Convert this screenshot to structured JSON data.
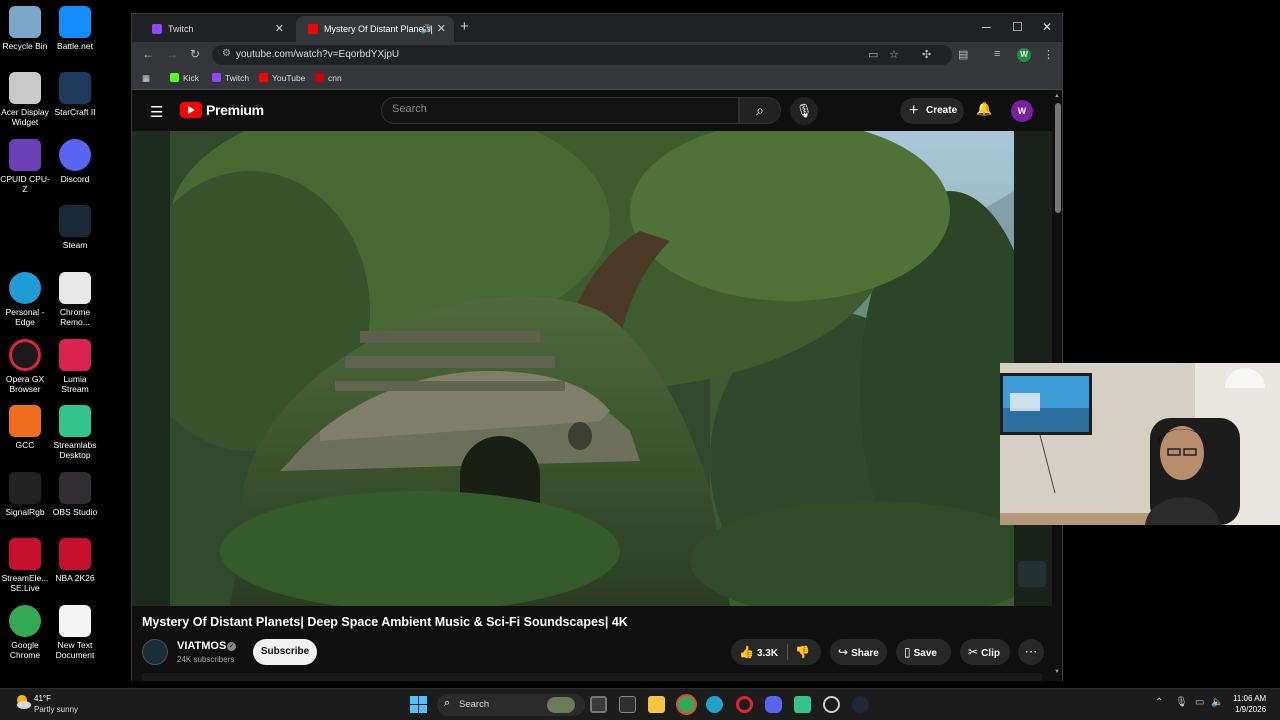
{
  "desktop": {
    "icons": [
      {
        "label": "Recycle Bin",
        "icon": "recycle-bin-icon"
      },
      {
        "label": "Battle.net",
        "icon": "battlenet-icon"
      },
      {
        "label": "Acer Display Widget",
        "icon": "acer-display-widget-icon"
      },
      {
        "label": "StarCraft II",
        "icon": "starcraft-icon"
      },
      {
        "label": "CPUID CPU-Z",
        "icon": "cpuz-icon"
      },
      {
        "label": "Discord",
        "icon": "discord-icon"
      },
      {
        "label": "Steam",
        "icon": "steam-icon"
      },
      {
        "label": "Personal - Edge",
        "icon": "edge-icon"
      },
      {
        "label": "Chrome Remo...",
        "icon": "chrome-remote-icon"
      },
      {
        "label": "Opera GX Browser",
        "icon": "opera-gx-icon"
      },
      {
        "label": "Lumia Stream",
        "icon": "lumia-stream-icon"
      },
      {
        "label": "GCC",
        "icon": "gcc-icon"
      },
      {
        "label": "Streamlabs Desktop",
        "icon": "streamlabs-icon"
      },
      {
        "label": "SignalRgb",
        "icon": "signalrgb-icon"
      },
      {
        "label": "OBS Studio",
        "icon": "obs-icon"
      },
      {
        "label": "StreamEle... SE.Live",
        "icon": "streamelements-icon"
      },
      {
        "label": "NBA 2K26",
        "icon": "nba2k26-icon"
      },
      {
        "label": "Google Chrome",
        "icon": "chrome-icon"
      },
      {
        "label": "New Text Document",
        "icon": "text-document-icon"
      }
    ]
  },
  "browser": {
    "tabs": [
      {
        "title": "Twitch",
        "icon": "twitch-icon"
      },
      {
        "title": "Mystery Of Distant Planets|",
        "icon": "youtube-icon",
        "active": true
      }
    ],
    "new_tab": "+",
    "url": "youtube.com/watch?v=EqorbdYXjpU",
    "profile_initial": "W",
    "bookmarks": [
      {
        "label": "Kick",
        "color": "#53fc18"
      },
      {
        "label": "Twitch",
        "color": "#9146ff"
      },
      {
        "label": "YouTube",
        "color": "#ff0000"
      },
      {
        "label": "cnn",
        "color": "#cc0000"
      }
    ]
  },
  "youtube": {
    "brand": "Premium",
    "search_placeholder": "Search",
    "create_label": "Create",
    "avatar_initial": "W",
    "video": {
      "title": "Mystery Of Distant Planets| Deep Space Ambient Music & Sci-Fi Soundscapes| 4K",
      "channel": "VIATMOS",
      "subscribers": "24K subscribers",
      "subscribe_label": "Subscribe",
      "likes": "3.3K",
      "share_label": "Share",
      "save_label": "Save",
      "clip_label": "Clip"
    }
  },
  "taskbar": {
    "weather_temp": "41°F",
    "weather_condition": "Partly sunny",
    "search_label": "Search",
    "time": "11:06 AM",
    "date": "1/9/2026"
  },
  "colors": {
    "youtube_red": "#ff0000",
    "page_bg": "#0f0f0f",
    "avatar_purple": "#7b1fa2"
  }
}
